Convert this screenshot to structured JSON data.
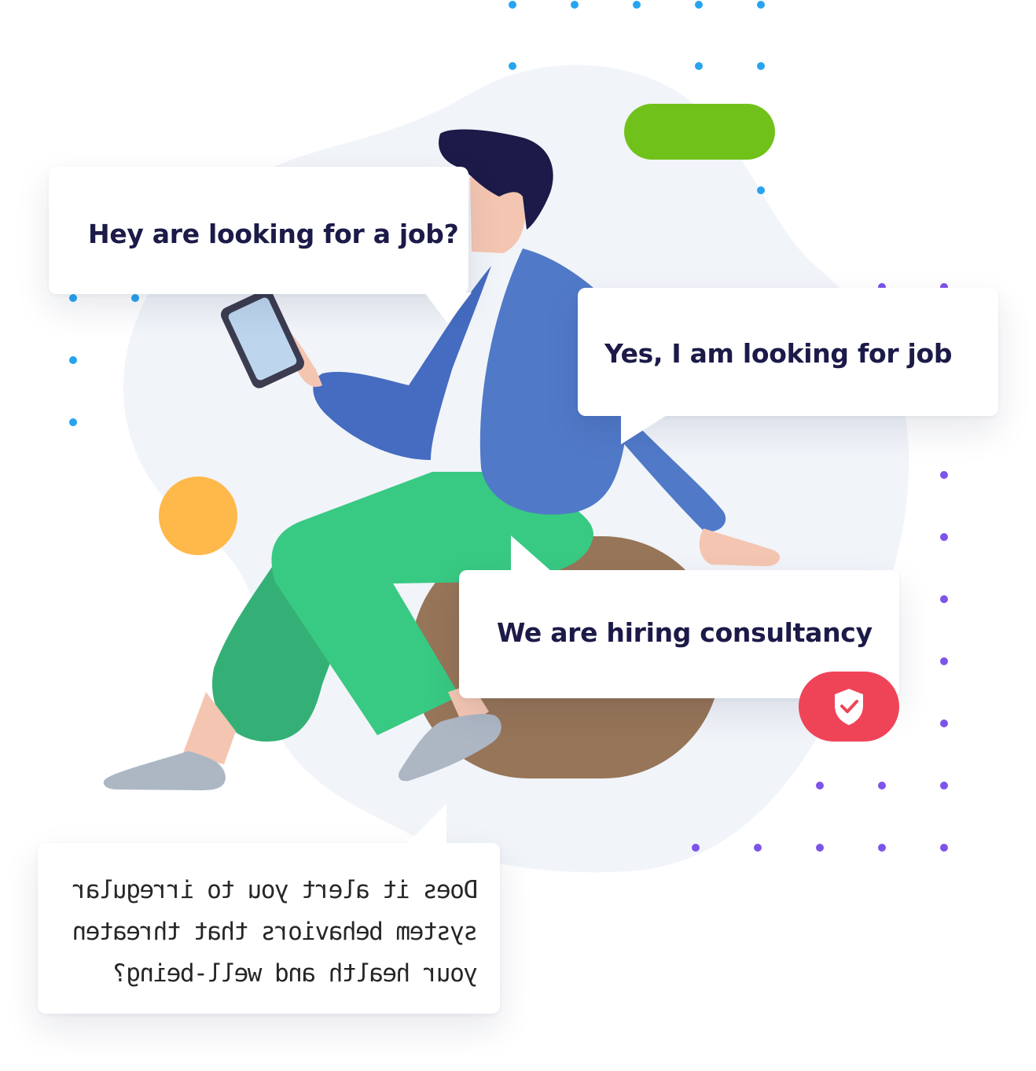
{
  "bubbles": {
    "question": "Hey are looking for a job?",
    "answer": "Yes, I am looking for job",
    "hiring": "We are hiring consultancy",
    "mirrored": "Does it alert you to irregular\nsystem behaviors that threaten\nyour health and well-being?"
  },
  "icons": {
    "badge": "shield-check-icon",
    "device": "smartphone-icon"
  },
  "colors": {
    "heading_text": "#1b1a48",
    "blob": "#f1f4f9",
    "blue_dots": "#27a4f0",
    "purple_dots": "#7c54ea",
    "green_pill": "#71c11b",
    "orange_circle": "#ffb84a",
    "red_badge": "#ef4458",
    "jacket": "#5079c8",
    "pants": "#38c983",
    "stool": "#977558",
    "hair": "#1b1a48",
    "skin": "#f4c6b2",
    "shoes": "#adb7c4"
  }
}
